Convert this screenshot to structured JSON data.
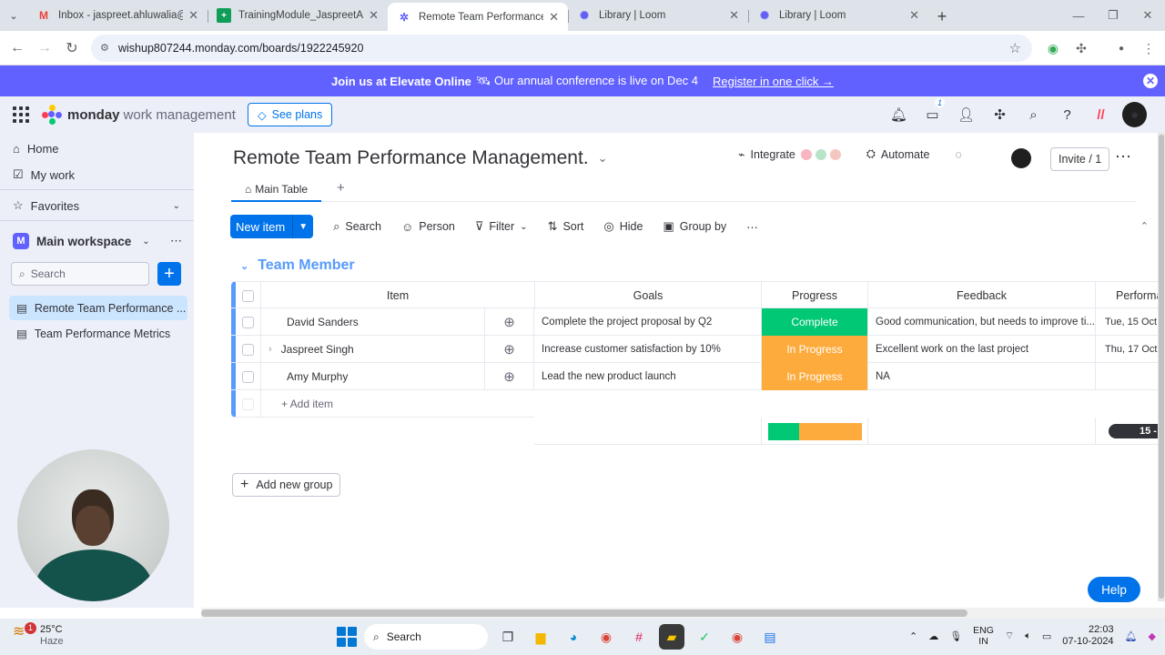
{
  "browser": {
    "tabs": [
      {
        "title": "Inbox - jaspreet.ahluwalia@wis",
        "icon": "gmail-icon",
        "active": false
      },
      {
        "title": "TrainingModule_JaspreetAhluw",
        "icon": "sheets-icon",
        "active": false
      },
      {
        "title": "Remote Team Performance Ma",
        "icon": "monday-icon",
        "active": true
      },
      {
        "title": "Library | Loom",
        "icon": "loom-icon",
        "active": false
      },
      {
        "title": "Library | Loom",
        "icon": "loom-icon",
        "active": false
      }
    ],
    "url": "wishup807244.monday.com/boards/1922245920"
  },
  "banner": {
    "bold": "Join us at Elevate Online",
    "text": "🛰 Our annual conference is live on Dec 4",
    "link": "Register in one click →"
  },
  "header": {
    "brand": "monday",
    "product": "work management",
    "see_plans": "See plans",
    "inbox_badge": "1"
  },
  "sidebar": {
    "home": "Home",
    "my_work": "My work",
    "favorites": "Favorites",
    "workspace_badge": "M",
    "workspace": "Main workspace",
    "search_placeholder": "Search",
    "boards": [
      {
        "label": "Remote Team Performance ...",
        "active": true
      },
      {
        "label": "Team Performance Metrics",
        "active": false
      }
    ]
  },
  "board": {
    "title": "Remote Team Performance Management.",
    "integrate": "Integrate",
    "automate": "Automate",
    "invite": "Invite / 1",
    "main_tab": "Main Table",
    "toolbar": {
      "new_item": "New item",
      "search": "Search",
      "person": "Person",
      "filter": "Filter",
      "sort": "Sort",
      "hide": "Hide",
      "group_by": "Group by"
    },
    "group": {
      "name": "Team Member",
      "columns": [
        "Item",
        "Goals",
        "Progress",
        "Feedback",
        "Performa"
      ],
      "rows": [
        {
          "item": "David Sanders",
          "goals": "Complete the project proposal by Q2",
          "progress": "Complete",
          "feedback": "Good communication, but needs to improve ti...",
          "date": "Tue, 15 Oct,"
        },
        {
          "item": "Jaspreet Singh",
          "goals": "Increase customer satisfaction by 10%",
          "progress": "In Progress",
          "feedback": "Excellent work on the last project",
          "date": "Thu, 17 Oct,"
        },
        {
          "item": "Amy Murphy",
          "goals": "Lead the new product launch",
          "progress": "In Progress",
          "feedback": "NA",
          "date": ""
        }
      ],
      "add_item": "+ Add item",
      "summary_timeline": "15 -",
      "progress_summary": {
        "complete_fraction": 0.333,
        "in_progress_fraction": 0.667
      }
    },
    "add_group": "Add new group",
    "help": "Help"
  },
  "colors": {
    "complete": "#00c875",
    "in_progress": "#fdab3d",
    "primary": "#0073ea",
    "banner": "#6161ff",
    "group": "#579bfc"
  },
  "taskbar": {
    "temp": "25°C",
    "condition": "Haze",
    "weather_badge": "1",
    "search": "Search",
    "lang1": "ENG",
    "lang2": "IN",
    "time": "22:03",
    "date": "07-10-2024"
  }
}
